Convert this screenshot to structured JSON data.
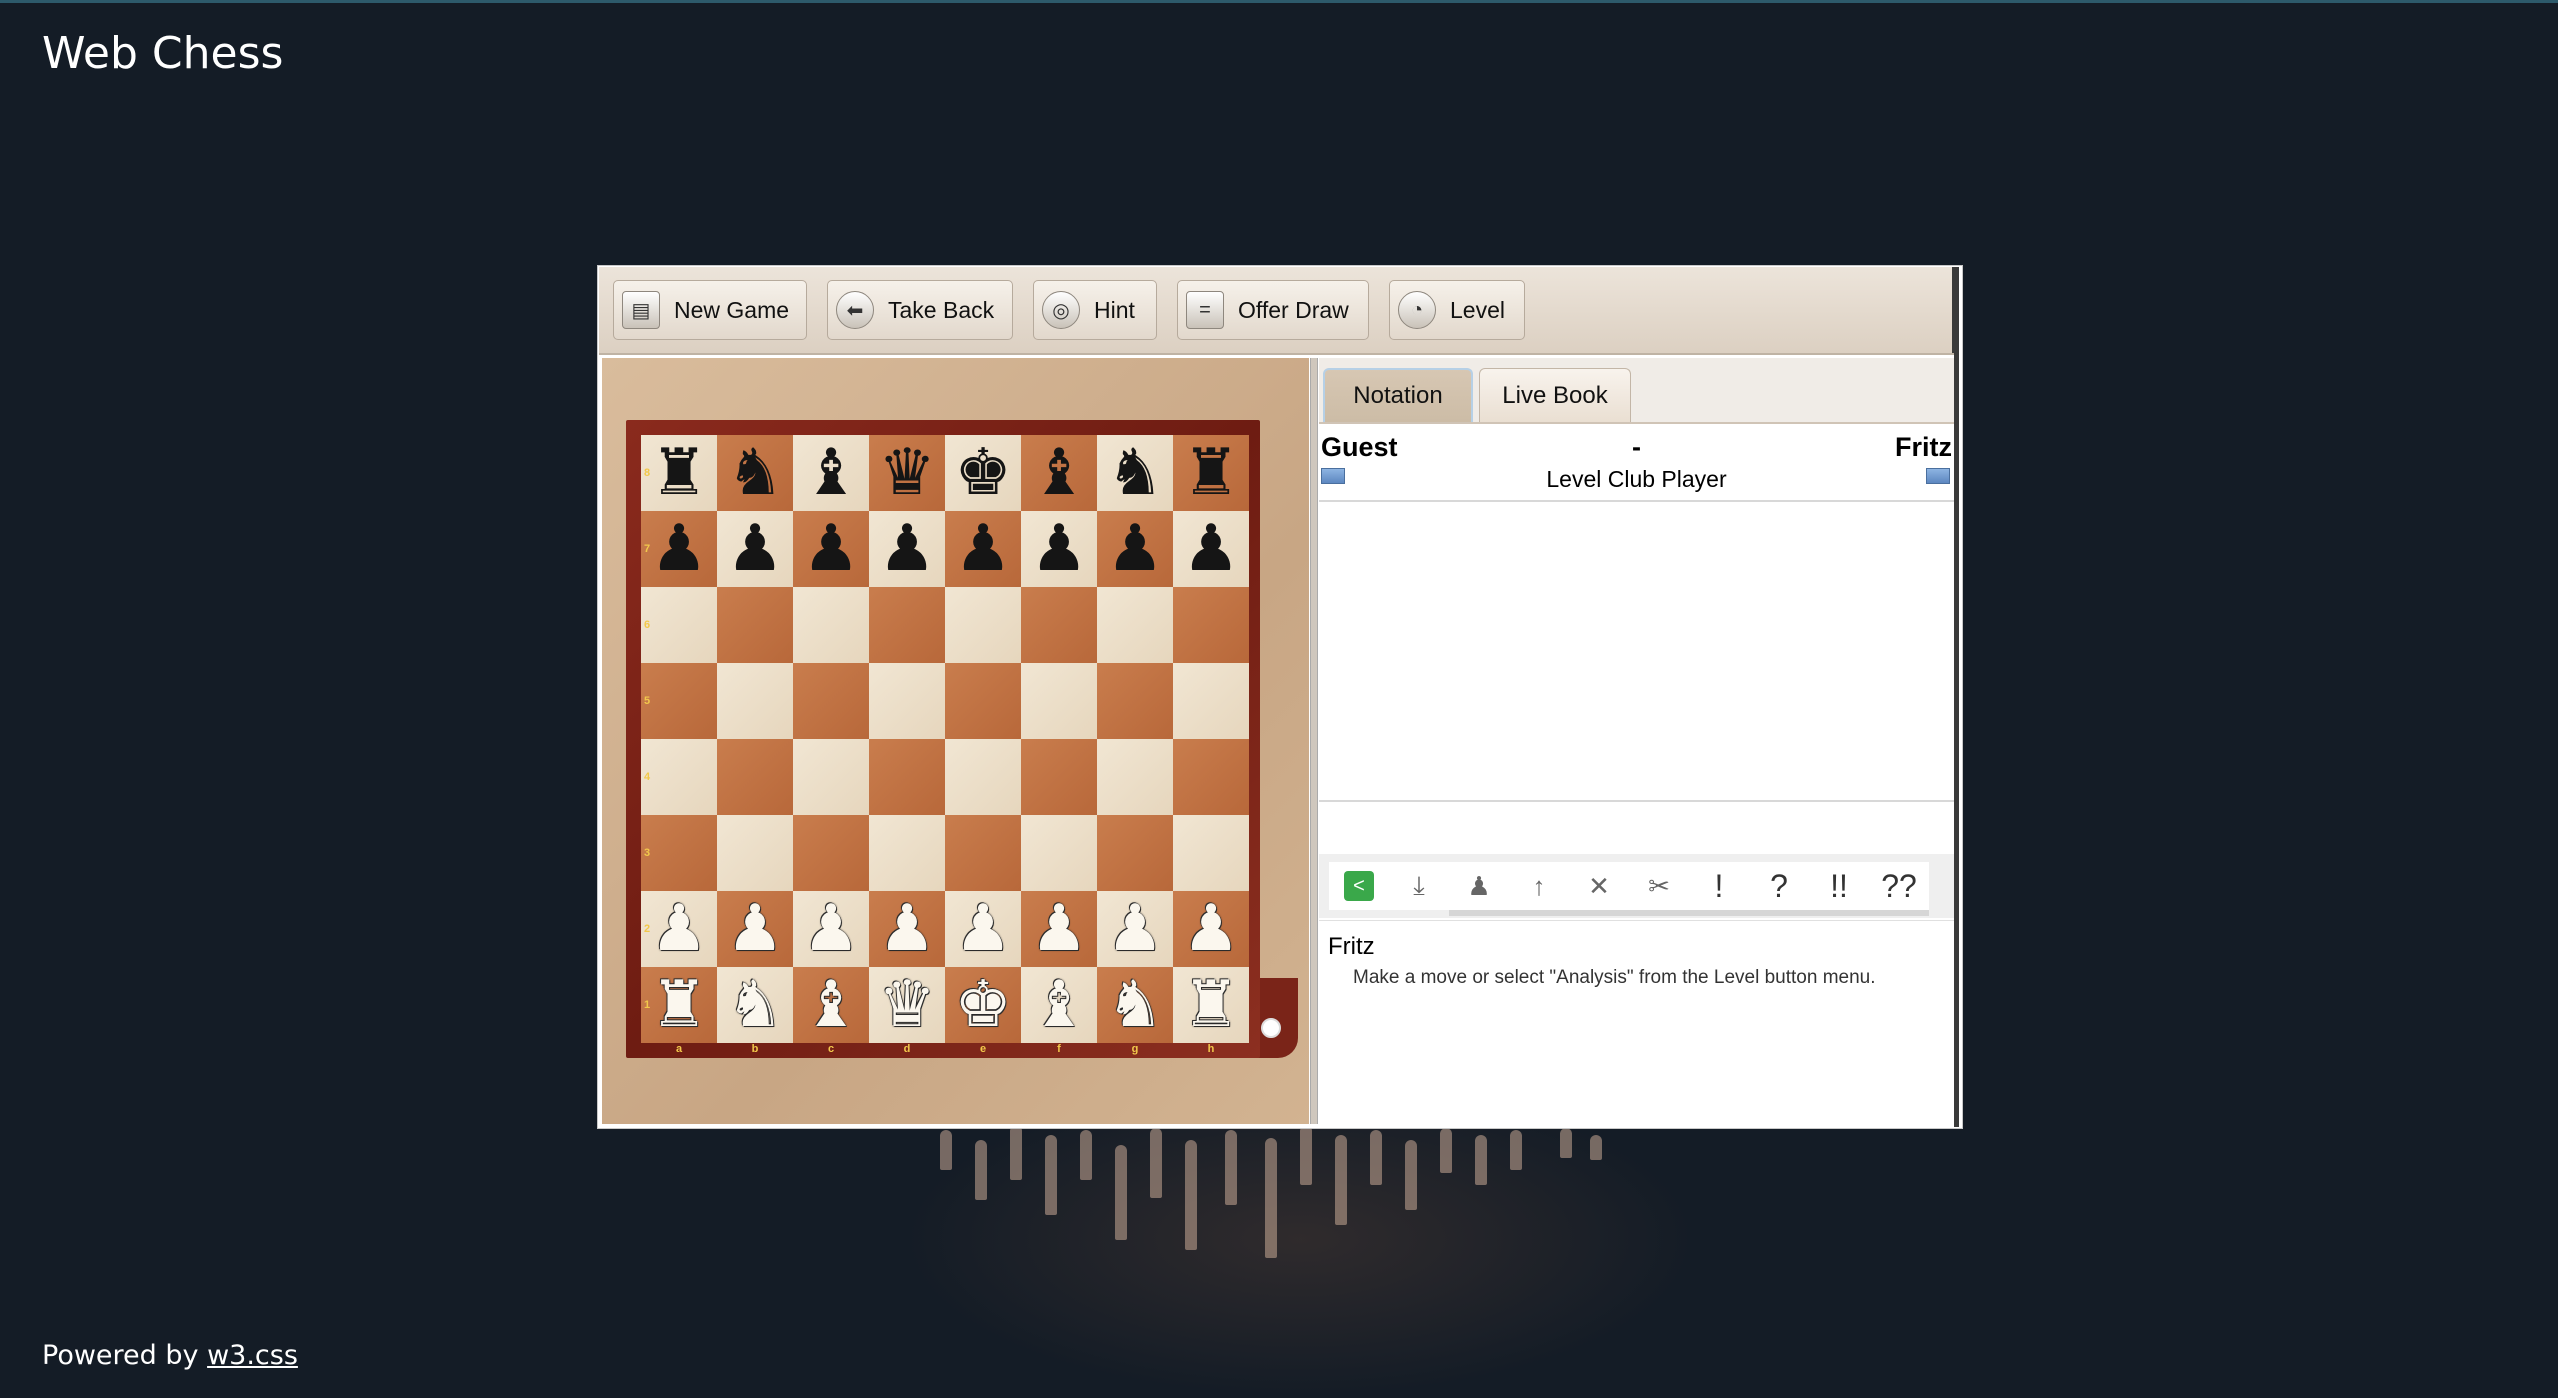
{
  "site": {
    "title": "Web Chess"
  },
  "footer": {
    "prefix": "Powered by ",
    "link_text": "w3.css"
  },
  "toolbar": {
    "new_game": "New Game",
    "take_back": "Take Back",
    "hint": "Hint",
    "offer_draw": "Offer Draw",
    "level": "Level"
  },
  "tabs": {
    "notation": "Notation",
    "live_book": "Live Book"
  },
  "players": {
    "white": "Guest",
    "separator": "-",
    "black": "Fritz",
    "level": "Level Club Player"
  },
  "annotations": [
    "!",
    "?",
    "!!",
    "??"
  ],
  "engine": {
    "name": "Fritz",
    "message": "Make a move or select \"Analysis\" from the Level button menu."
  },
  "board": {
    "files": [
      "a",
      "b",
      "c",
      "d",
      "e",
      "f",
      "g",
      "h"
    ],
    "ranks": [
      "8",
      "7",
      "6",
      "5",
      "4",
      "3",
      "2",
      "1"
    ],
    "position": [
      [
        "r",
        "n",
        "b",
        "q",
        "k",
        "b",
        "n",
        "r"
      ],
      [
        "p",
        "p",
        "p",
        "p",
        "p",
        "p",
        "p",
        "p"
      ],
      [
        "",
        "",
        "",
        "",
        "",
        "",
        "",
        ""
      ],
      [
        "",
        "",
        "",
        "",
        "",
        "",
        "",
        ""
      ],
      [
        "",
        "",
        "",
        "",
        "",
        "",
        "",
        ""
      ],
      [
        "",
        "",
        "",
        "",
        "",
        "",
        "",
        ""
      ],
      [
        "P",
        "P",
        "P",
        "P",
        "P",
        "P",
        "P",
        "P"
      ],
      [
        "R",
        "N",
        "B",
        "Q",
        "K",
        "B",
        "N",
        "R"
      ]
    ],
    "colors": {
      "light": "#eadbc4",
      "dark": "#c07243",
      "frame": "#7a2418",
      "coord": "#f2c84b"
    }
  }
}
